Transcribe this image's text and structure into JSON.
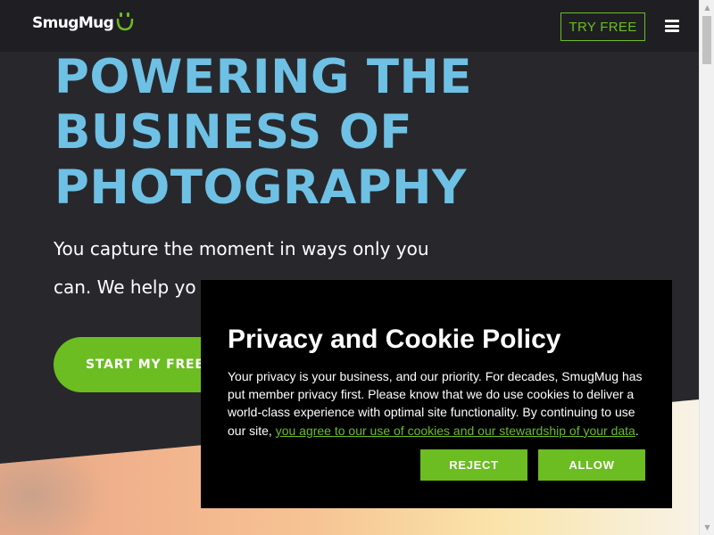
{
  "header": {
    "logo_text": "SmugMug",
    "try_free_label": "TRY FREE"
  },
  "hero": {
    "headline": [
      "POWERING THE",
      "BUSINESS OF",
      "PHOTOGRAPHY"
    ],
    "subtext_line1": "You capture the moment in ways only you",
    "subtext_line2": "can. We help yo",
    "start_button_label": "START MY FREE"
  },
  "cookie_dialog": {
    "title": "Privacy and Cookie Policy",
    "body": "Your privacy is your business, and our priority. For decades, SmugMug has put member privacy first. Please know that we do use cookies to deliver a world-class experience with optimal site functionality. By continuing to use our site, ",
    "link_text": "you agree to our use of cookies and our stewardship of your data",
    "body_end": ".",
    "reject_label": "REJECT",
    "allow_label": "ALLOW"
  },
  "icons": {
    "logo_mark": "smiley-icon",
    "menu": "hamburger-menu-icon",
    "scroll_up": "scroll-up-arrow",
    "scroll_down": "scroll-down-arrow"
  },
  "colors": {
    "brand_green": "#6bbd22",
    "headline_blue": "#6ec1e4",
    "background": "#28282c",
    "dialog_bg": "#000000"
  }
}
